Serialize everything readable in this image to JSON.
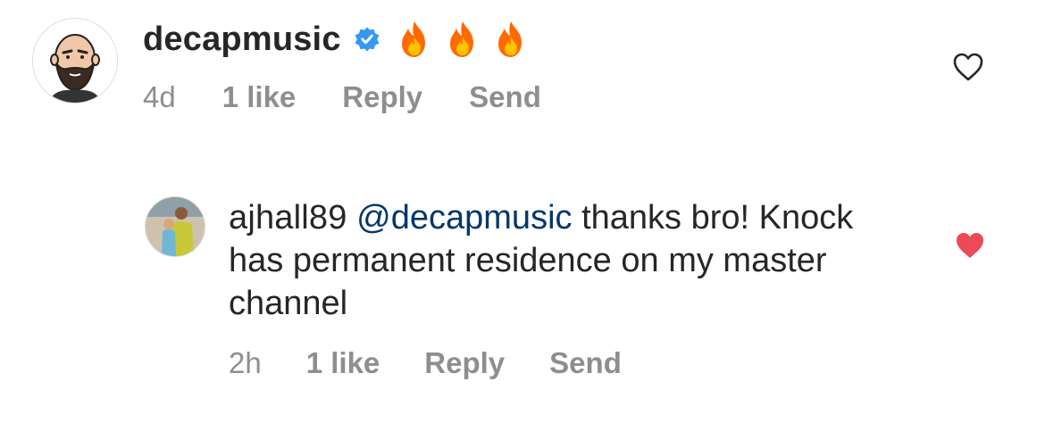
{
  "comments": [
    {
      "username": "decapmusic",
      "verified": true,
      "text": "🔥🔥🔥",
      "time": "4d",
      "likes": "1 like",
      "reply_label": "Reply",
      "send_label": "Send",
      "liked": false,
      "avatar": "bald-bearded-man-illustration"
    },
    {
      "username": "ajhall89",
      "mention": "@decapmusic",
      "text": "thanks bro! Knock has permanent residence on my master channel",
      "time": "2h",
      "likes": "1 like",
      "reply_label": "Reply",
      "send_label": "Send",
      "liked": true,
      "avatar": "user-photo"
    }
  ],
  "colors": {
    "text": "#262626",
    "meta": "#8e8e8e",
    "mention": "#00376b",
    "verified": "#3897f0",
    "like_active": "#ed4956"
  },
  "icons": [
    "verified-badge-icon",
    "fire-emoji-icon",
    "heart-outline-icon",
    "heart-filled-icon"
  ]
}
